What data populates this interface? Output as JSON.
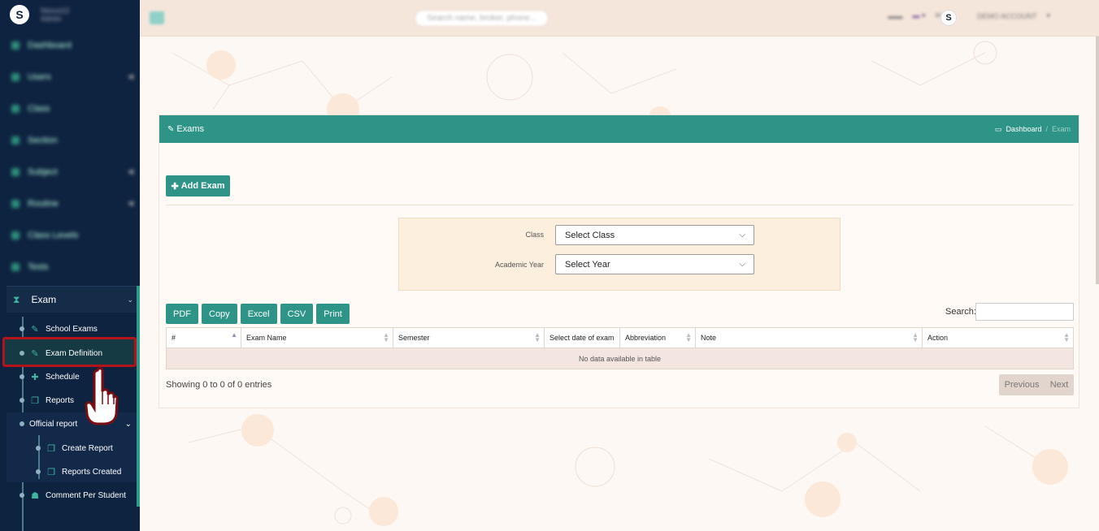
{
  "sidebar": {
    "brand_line1": "Nexus12",
    "brand_line2": "Admin",
    "items": [
      {
        "label": "Dashboard",
        "has_caret": false
      },
      {
        "label": "Users",
        "has_caret": true
      },
      {
        "label": "Class",
        "has_caret": false
      },
      {
        "label": "Section",
        "has_caret": false
      },
      {
        "label": "Subject",
        "has_caret": true
      },
      {
        "label": "Routine",
        "has_caret": true
      },
      {
        "label": "Class Levels",
        "has_caret": false
      },
      {
        "label": "Tests",
        "has_caret": false
      }
    ],
    "exam": {
      "label": "Exam",
      "sub_items": [
        {
          "label": "School Exams",
          "icon": "pencil-icon"
        },
        {
          "label": "Exam Definition",
          "icon": "pencil-icon"
        },
        {
          "label": "Schedule",
          "icon": "puzzle-icon"
        },
        {
          "label": "Reports",
          "icon": "copy-icon"
        }
      ],
      "official_report": {
        "label": "Official report",
        "children": [
          {
            "label": "Create Report"
          },
          {
            "label": "Reports Created"
          }
        ]
      },
      "comment": {
        "label": "Comment Per Student"
      }
    }
  },
  "topbar": {
    "search_placeholder": "Search name, broker, phone...",
    "account_label": "DEMO ACCOUNT"
  },
  "panel": {
    "title": "Exams",
    "breadcrumb_home": "Dashboard",
    "breadcrumb_separator": "/",
    "breadcrumb_current": "Exam",
    "add_button": "Add Exam",
    "filters": {
      "class_label": "Class",
      "class_value": "Select Class",
      "year_label": "Academic Year",
      "year_value": "Select Year"
    },
    "export_buttons": [
      "PDF",
      "Copy",
      "Excel",
      "CSV",
      "Print"
    ],
    "search_label": "Search:",
    "table": {
      "columns": [
        "#",
        "Exam Name",
        "Semester",
        "Select date of exam",
        "Abbreviation",
        "Note",
        "Action"
      ],
      "empty_message": "No data available in table"
    },
    "showing": "Showing 0 to 0 of 0 entries",
    "pager": {
      "previous": "Previous",
      "next": "Next"
    }
  },
  "colors": {
    "sidebar_bg": "#0e2340",
    "accent": "#2e9488",
    "highlight": "#b3141c"
  }
}
